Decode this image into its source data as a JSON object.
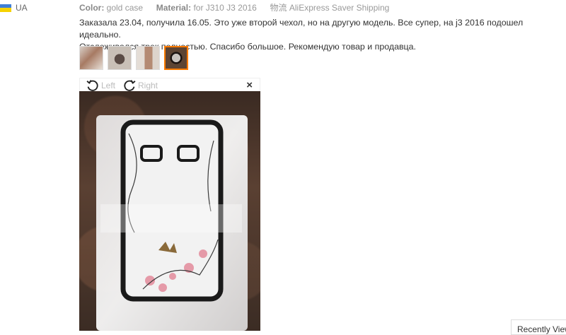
{
  "country": {
    "code": "UA"
  },
  "meta": {
    "color_label": "Color:",
    "color_value": "gold case",
    "material_label": "Material:",
    "material_value": "for J310 J3 2016",
    "shipping_label": "物流",
    "shipping_value": "AliExpress Saver Shipping"
  },
  "review": {
    "line1": "Заказала 23.04, получила 16.05. Это уже второй чехол, но на другую модель. Все супер, на j3 2016 подошел идеально.",
    "line2": "Отслеживался трек полностью. Спасибо большое. Рекомендую товар и продавца."
  },
  "thumbnails": {
    "count": 4,
    "active_index": 4
  },
  "viewer": {
    "rotate_left": "Left",
    "rotate_right": "Right",
    "close": "×"
  },
  "recently_viewed": "Recently Viewed",
  "colors": {
    "accent": "#ff7a00"
  }
}
